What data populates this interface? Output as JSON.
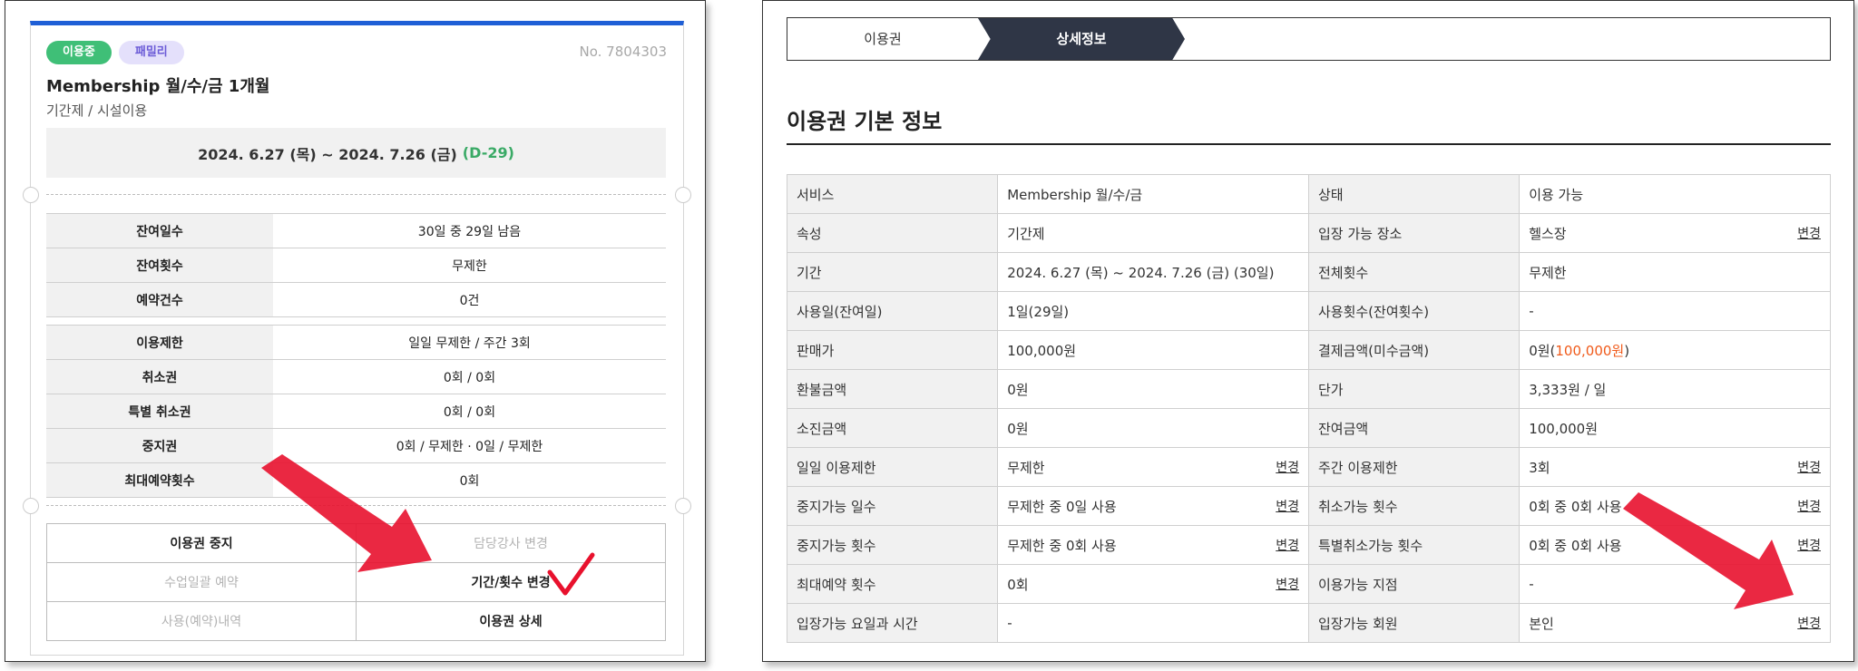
{
  "left_card": {
    "badges": [
      "이용중",
      "패밀리"
    ],
    "number": "No. 7804303",
    "title": "Membership 월/수/금 1개월",
    "subtitle": "기간제 / 시설이용",
    "period": "2024. 6.27 (목) ~ 2024. 7.26 (금)",
    "dday": "(D-29)",
    "rows_a": [
      {
        "label": "잔여일수",
        "value": "30일 중 29일 남음"
      },
      {
        "label": "잔여횟수",
        "value": "무제한"
      },
      {
        "label": "예약건수",
        "value": "0건"
      }
    ],
    "rows_b": [
      {
        "label": "이용제한",
        "value": "일일 무제한 / 주간 3회"
      },
      {
        "label": "취소권",
        "value": "0회 / 0회"
      },
      {
        "label": "특별 취소권",
        "value": "0회 / 0회"
      },
      {
        "label": "중지권",
        "value": "0회 / 무제한 · 0일 / 무제한"
      },
      {
        "label": "최대예약횟수",
        "value": "0회"
      }
    ],
    "actions": [
      {
        "label": "이용권 중지",
        "enabled": true
      },
      {
        "label": "담당강사 변경",
        "enabled": false
      },
      {
        "label": "수업일괄 예약",
        "enabled": false
      },
      {
        "label": "기간/횟수 변경",
        "enabled": true
      },
      {
        "label": "사용(예약)내역",
        "enabled": false
      },
      {
        "label": "이용권 상세",
        "enabled": true
      }
    ]
  },
  "right_panel": {
    "tabs": [
      "이용권",
      "상세정보"
    ],
    "active_tab": "상세정보",
    "section_title": "이용권 기본 정보",
    "change_label": "변경",
    "rows": [
      {
        "k1": "서비스",
        "v1": "Membership 월/수/금",
        "k2": "상태",
        "v2": "이용 가능"
      },
      {
        "k1": "속성",
        "v1": "기간제",
        "k2": "입장 가능 장소",
        "v2": "헬스장"
      },
      {
        "k1": "기간",
        "v1": "2024. 6.27 (목) ~ 2024. 7.26 (금) (30일)",
        "k2": "전체횟수",
        "v2": "무제한"
      },
      {
        "k1": "사용일(잔여일)",
        "v1": "1일(29일)",
        "k2": "사용횟수(잔여횟수)",
        "v2": "-"
      },
      {
        "k1": "판매가",
        "v1": "100,000원",
        "k2": "결제금액(미수금액)",
        "v2": "0원",
        "v2_extra": "100,000원"
      },
      {
        "k1": "환불금액",
        "v1": "0원",
        "k2": "단가",
        "v2": "3,333원 / 일"
      },
      {
        "k1": "소진금액",
        "v1": "0원",
        "k2": "잔여금액",
        "v2": "100,000원"
      },
      {
        "k1": "일일 이용제한",
        "v1": "무제한",
        "k2": "주간 이용제한",
        "v2": "3회"
      },
      {
        "k1": "중지가능 일수",
        "v1": "무제한 중 0일 사용",
        "k2": "취소가능 횟수",
        "v2": "0회 중 0회 사용"
      },
      {
        "k1": "중지가능 횟수",
        "v1": "무제한 중 0회 사용",
        "k2": "특별취소가능 횟수",
        "v2": "0회 중 0회 사용"
      },
      {
        "k1": "최대예약 횟수",
        "v1": "0회",
        "k2": "이용가능 지점",
        "v2": "-"
      },
      {
        "k1": "입장가능 요일과 시간",
        "v1": "-",
        "k2": "입장가능 회원",
        "v2": "본인"
      }
    ]
  },
  "colors": {
    "accent_blue": "#1f5fd6",
    "status_green": "#3aaa66",
    "unpaid_orange": "#f05a1a",
    "tab_active": "#2f3646",
    "annotation_red": "#e8112d"
  }
}
